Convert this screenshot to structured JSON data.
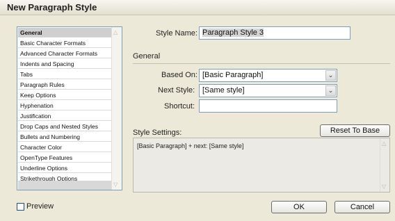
{
  "dialog": {
    "title": "New Paragraph Style"
  },
  "sidebar": {
    "items": [
      "General",
      "Basic Character Formats",
      "Advanced Character Formats",
      "Indents and Spacing",
      "Tabs",
      "Paragraph Rules",
      "Keep Options",
      "Hyphenation",
      "Justification",
      "Drop Caps and Nested Styles",
      "Bullets and Numbering",
      "Character Color",
      "OpenType Features",
      "Underline Options",
      "Strikethrough Options"
    ],
    "selected": "General"
  },
  "style_name": {
    "label": "Style Name:",
    "value": "Paragraph Style 3"
  },
  "general_section": {
    "heading": "General"
  },
  "based_on": {
    "label": "Based On:",
    "value": "[Basic Paragraph]"
  },
  "next_style": {
    "label": "Next Style:",
    "value": "[Same style]"
  },
  "shortcut": {
    "label": "Shortcut:",
    "value": ""
  },
  "style_settings": {
    "label": "Style Settings:",
    "reset_button": "Reset To Base",
    "text": "[Basic Paragraph] + next: [Same style]"
  },
  "preview": {
    "label": "Preview",
    "checked": false
  },
  "buttons": {
    "ok": "OK",
    "cancel": "Cancel"
  },
  "icons": {
    "dropdown": "chevron-down-icon",
    "scroll_up": "scroll-up-arrow-icon",
    "scroll_down": "scroll-down-arrow-icon"
  }
}
